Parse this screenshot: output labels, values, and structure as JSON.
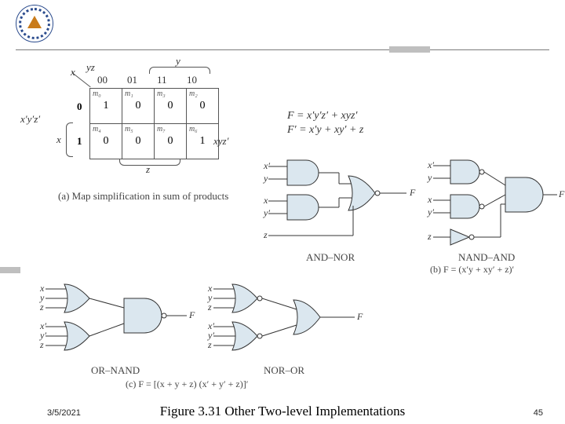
{
  "logo": {
    "name": "university-seal"
  },
  "footer": {
    "date": "3/5/2021",
    "title": "Figure 3.31 Other Two-level Implementations",
    "page": "45"
  },
  "equations": {
    "F": "F = x′y′z′ + xyz′",
    "Fp": "F′ = x′y + xy′ + z"
  },
  "kmap": {
    "axis_xy": "x",
    "axis_yz": "yz",
    "cols": [
      "00",
      "01",
      "11",
      "10"
    ],
    "rows": [
      "0",
      "1"
    ],
    "minterms_top": [
      "m₀",
      "m₁",
      "m₃",
      "m₂"
    ],
    "minterms_bottom": [
      "m₄",
      "m₅",
      "m₇",
      "m₆"
    ],
    "values_top": [
      "1",
      "0",
      "0",
      "0"
    ],
    "values_bottom": [
      "0",
      "0",
      "0",
      "1"
    ],
    "brace_y": "y",
    "brace_z": "z",
    "brace_x": "x",
    "label_top_left": "x′y′z′",
    "label_right": "xyz′",
    "caption": "(a) Map simplification in sum of products"
  },
  "circ_b": {
    "left": {
      "in1": "x′",
      "in2": "y",
      "in3": "x",
      "in4": "y′",
      "in5": "z",
      "out": "F",
      "name": "AND–NOR"
    },
    "right": {
      "in1": "x′",
      "in2": "y",
      "in3": "x",
      "in4": "y′",
      "in5": "z",
      "out": "F",
      "name": "NAND–AND"
    },
    "caption": "(b) F = (x′y + xy′ + z)′"
  },
  "circ_c": {
    "left": {
      "in1": "x",
      "in2": "y",
      "in3": "z",
      "in4": "x′",
      "in5": "y′",
      "in6": "z",
      "out": "F",
      "name": "OR–NAND"
    },
    "right": {
      "in1": "x",
      "in2": "y",
      "in3": "z",
      "in4": "x′",
      "in5": "y′",
      "in6": "z",
      "out": "F",
      "name": "NOR–OR"
    },
    "caption": "(c) F = [(x + y + z) (x′ + y′ + z)]′"
  },
  "chart_data": {
    "type": "table",
    "title": "Karnaugh map for F(x,y,z)",
    "row_var": "x",
    "col_vars": "yz",
    "columns": [
      "00",
      "01",
      "11",
      "10"
    ],
    "rows": [
      {
        "x": "0",
        "cells": [
          1,
          0,
          0,
          0
        ],
        "minterms": [
          "m0",
          "m1",
          "m3",
          "m2"
        ]
      },
      {
        "x": "1",
        "cells": [
          0,
          0,
          0,
          1
        ],
        "minterms": [
          "m4",
          "m5",
          "m7",
          "m6"
        ]
      }
    ],
    "implicants": [
      "x'y'z'  (cell m0)",
      "xyz'  (cell m6)"
    ]
  }
}
